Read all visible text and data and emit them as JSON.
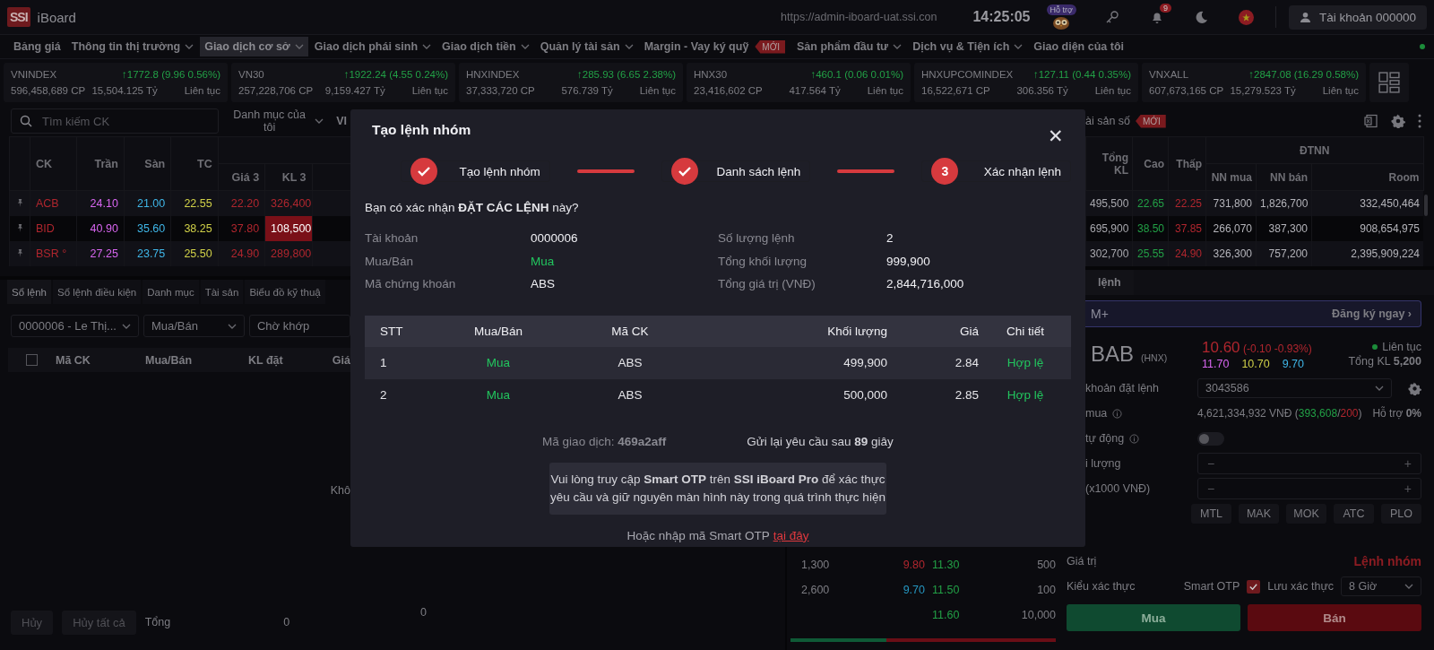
{
  "header": {
    "logo": "SSI",
    "app_name": "iBoard",
    "url": "https://admin-iboard-uat.ssi.con",
    "time": "14:25:05",
    "support_badge": "Hỗ trợ",
    "notification_count": "9",
    "account": "Tài khoản 000000"
  },
  "menu": [
    {
      "label": "Bảng giá",
      "dropdown": false,
      "selected": false
    },
    {
      "label": "Thông tin thị trường",
      "dropdown": true,
      "selected": false
    },
    {
      "label": "Giao dịch cơ sở",
      "dropdown": true,
      "selected": true
    },
    {
      "label": "Giao dịch phái sinh",
      "dropdown": true,
      "selected": false
    },
    {
      "label": "Giao dịch tiền",
      "dropdown": true,
      "selected": false
    },
    {
      "label": "Quản lý tài sản",
      "dropdown": true,
      "selected": false
    },
    {
      "label": "Margin - Vay ký quỹ",
      "dropdown": false,
      "selected": false,
      "badge": "MỚI"
    },
    {
      "label": "Sản phẩm đầu tư",
      "dropdown": true,
      "selected": false
    },
    {
      "label": "Dịch vụ & Tiện ích",
      "dropdown": true,
      "selected": false
    },
    {
      "label": "Giao diện của tôi",
      "dropdown": false,
      "selected": false
    }
  ],
  "indices": [
    {
      "name": "VNINDEX",
      "change": "↑1772.8 (9.96 0.56%)",
      "color": "#22a046",
      "volume": "596,458,689 CP",
      "value": "15,504.125 Tỷ",
      "status": "Liên tục"
    },
    {
      "name": "VN30",
      "change": "↑1922.24 (4.55 0.24%)",
      "color": "#22a046",
      "volume": "257,228,706 CP",
      "value": "9,159.427 Tỷ",
      "status": "Liên tục"
    },
    {
      "name": "HNXINDEX",
      "change": "↑285.93 (6.65 2.38%)",
      "color": "#22a046",
      "volume": "37,333,720 CP",
      "value": "576.739 Tỷ",
      "status": "Liên tục"
    },
    {
      "name": "HNX30",
      "change": "↑460.1 (0.06 0.01%)",
      "color": "#22a046",
      "volume": "23,416,602 CP",
      "value": "417.564 Tỷ",
      "status": "Liên tục"
    },
    {
      "name": "HNXUPCOMINDEX",
      "change": "↑127.11 (0.44 0.35%)",
      "color": "#22a046",
      "volume": "16,522,671 CP",
      "value": "306.356 Tỷ",
      "status": "Liên tục"
    },
    {
      "name": "VNXALL",
      "change": "↑2847.08 (16.29 0.58%)",
      "color": "#22a046",
      "volume": "607,673,165 CP",
      "value": "15,279.523 Tỷ",
      "status": "Liên tục"
    }
  ],
  "watchlist": {
    "search_placeholder": "Tìm kiếm CK",
    "category": "Danh mục của tôi",
    "tab_cut": "VI",
    "tab_right": "ài sản số",
    "tab_right_badge": "MỚI",
    "columns_left": [
      "CK",
      "Trần",
      "Sàn",
      "TC",
      "Giá 3",
      "KL 3"
    ],
    "columns_right": [
      "Tổng KL",
      "Cao",
      "Thấp"
    ],
    "group_right": "ĐTNN",
    "columns_group": [
      "NN mua",
      "NN bán",
      "Room"
    ],
    "rows": [
      {
        "symbol": "ACB",
        "color": "#b0262e",
        "ceiling": "24.10",
        "floor": "21.00",
        "reference": "22.55",
        "price_3": "22.20",
        "volume_3": "326,400",
        "flash": false,
        "total_volume": "495,500",
        "high": {
          "value": "22.65",
          "color": "#22a046"
        },
        "low": {
          "value": "22.25",
          "color": "#b0262e"
        },
        "foreign_buy": "731,800",
        "foreign_sell": "1,826,700",
        "room": "332,450,464"
      },
      {
        "symbol": "BID",
        "color": "#b0262e",
        "ceiling": "40.90",
        "floor": "35.60",
        "reference": "38.25",
        "price_3": "37.80",
        "volume_3": "108,500",
        "flash": true,
        "total_volume": "695,900",
        "high": {
          "value": "38.50",
          "color": "#22a046"
        },
        "low": {
          "value": "37.85",
          "color": "#b0262e"
        },
        "foreign_buy": "266,070",
        "foreign_sell": "387,300",
        "room": "908,654,975"
      },
      {
        "symbol": "BSR °",
        "color": "#b0262e",
        "ceiling": "27.25",
        "floor": "23.75",
        "reference": "25.50",
        "price_3": "24.90",
        "volume_3": "289,800",
        "flash": false,
        "total_volume": "302,700",
        "high": {
          "value": "25.55",
          "color": "#22a046"
        },
        "low": {
          "value": "24.90",
          "color": "#b0262e"
        },
        "foreign_buy": "326,300",
        "foreign_sell": "757,200",
        "room": "2,395,909,224"
      }
    ]
  },
  "orders_panel": {
    "tabs": [
      {
        "label": "Sổ lệnh",
        "selected": true
      },
      {
        "label": "Sổ lệnh điều kiện",
        "selected": false
      },
      {
        "label": "Danh mục",
        "selected": false
      },
      {
        "label": "Tài sản",
        "selected": false
      },
      {
        "label": "Biểu đồ kỹ thuậ",
        "selected": false
      }
    ],
    "filters": [
      {
        "value": "0000006  - Le Thị...",
        "chevron": true
      },
      {
        "value": "Mua/Bán",
        "chevron": true
      },
      {
        "value": "Chờ khớp",
        "chevron": false
      }
    ],
    "select_all_checked": false,
    "columns": [
      "Mã CK",
      "Mua/Bán",
      "KL đặt",
      "Giá"
    ],
    "empty_text": "Khô",
    "buttons": [
      "Hủy",
      "Hủy tất cả"
    ],
    "total_label": "Tổng",
    "totals": [
      "0",
      "0"
    ]
  },
  "order_book": {
    "rows": [
      {
        "buy_volume": "1,300",
        "buy_price": {
          "value": "9.80",
          "color": "#b0262e"
        },
        "sell_price": {
          "value": "11.30",
          "color": "#22a046"
        },
        "sell_volume": "500"
      },
      {
        "buy_volume": "2,600",
        "buy_price": {
          "value": "9.70",
          "color": "#2596c0"
        },
        "sell_price": {
          "value": "11.50",
          "color": "#22a046"
        },
        "sell_volume": "100"
      },
      {
        "sell_price": {
          "value": "11.60",
          "color": "#22a046"
        },
        "sell_volume": "10,000"
      }
    ],
    "level": 0.36
  },
  "order_form": {
    "tab": "lệnh",
    "promo": "M+",
    "promo_link": "Đăng ký ngay ›",
    "symbol": "BAB",
    "exchange": "(HNX)",
    "price": "10.60",
    "price_change": "(-0.10 -0.93%)",
    "color": "#b0262e",
    "ceiling": "11.70",
    "reference": "10.70",
    "floor": "9.70",
    "session": "Liên tục",
    "total_volume_label": "Tổng KL",
    "total_volume": "5,200",
    "account_label": "khoản đặt lệnh",
    "account": "3043586",
    "buying_power_label": "mua",
    "buying_power": [
      {
        "text": "4,621,334,932 VNĐ ("
      },
      {
        "text": "393,608",
        "color": "#22a046"
      },
      {
        "text": "/"
      },
      {
        "text": "200",
        "color": "#b0262e"
      },
      {
        "text": ")"
      }
    ],
    "support": "Hỗ trợ **0%**",
    "auto_label": "tự động",
    "auto_on": false,
    "quantity_label": "i lượng",
    "price_label": "(x1000 VNĐ)",
    "minus": "−",
    "plus": "+",
    "order_types": [
      "MTL",
      "MAK",
      "MOK",
      "ATC",
      "PLO"
    ],
    "value_label": "Giá trị",
    "group_order": "Lệnh nhóm",
    "auth_label": "Kiểu xác thực",
    "auth_method": "Smart OTP",
    "remember_checked": true,
    "remember_label": "Lưu xác thực",
    "remember_duration": "8 Giờ",
    "buy": "Mua",
    "sell": "Bán"
  },
  "modal": {
    "title": "Tạo lệnh nhóm",
    "close": "✕",
    "steps": [
      {
        "label": "Tạo lệnh nhóm",
        "done": true
      },
      {
        "label": "Danh sách lệnh",
        "done": true
      },
      {
        "label": "Xác nhận lệnh",
        "done": false,
        "number": "3"
      }
    ],
    "question": "Bạn có xác nhận **ĐẶT CÁC LỆNH** này?",
    "summary_left": [
      {
        "label": "Tài khoản",
        "value": "0000006"
      },
      {
        "label": "Mua/Bán",
        "value": "Mua",
        "color": "#22c55e"
      },
      {
        "label": "Mã chứng khoán",
        "value": "ABS"
      }
    ],
    "summary_right": [
      {
        "label": "Số lượng lệnh",
        "value": "2"
      },
      {
        "label": "Tổng khối lượng",
        "value": "999,900"
      },
      {
        "label": "Tổng giá trị (VNĐ)",
        "value": "2,844,716,000"
      }
    ],
    "columns": [
      "STT",
      "Mua/Bán",
      "Mã CK",
      "Khối lượng",
      "Giá",
      "Chi tiết"
    ],
    "orders": [
      {
        "index": "1",
        "side": {
          "value": "Mua",
          "color": "#22c55e"
        },
        "symbol": "ABS",
        "volume": "499,900",
        "price": "2.84",
        "status": {
          "value": "Hợp lệ",
          "color": "#22c55e"
        },
        "highlighted": true
      },
      {
        "index": "2",
        "side": {
          "value": "Mua",
          "color": "#22c55e"
        },
        "symbol": "ABS",
        "volume": "500,000",
        "price": "2.85",
        "status": {
          "value": "Hợp lệ",
          "color": "#22c55e"
        },
        "highlighted": false
      }
    ],
    "transaction": "Mã giao dịch: **469a2aff**",
    "resend": "Gửi lại yêu cầu sau **89** giây",
    "note": "Vui lòng truy cập **Smart OTP** trên **SSI iBoard Pro** để xác thực yêu cầu và giữ nguyên màn hình này trong quá trình thực hiện",
    "alt_text": "Hoặc nhập mã Smart OTP",
    "alt_link": "tại đây"
  }
}
